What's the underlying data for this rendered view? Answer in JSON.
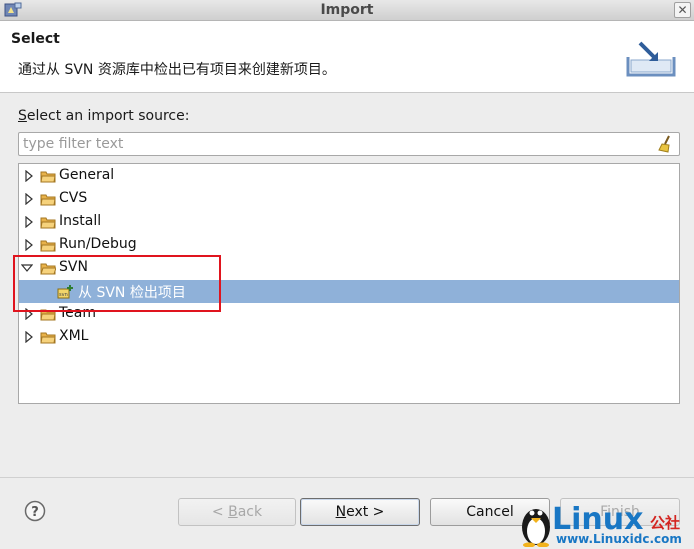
{
  "window": {
    "title": "Import",
    "close_glyph": "✕"
  },
  "header": {
    "title": "Select",
    "description": "通过从 SVN 资源库中检出已有项目来创建新项目。",
    "icon": "import-wizard-icon"
  },
  "source_label": {
    "mnemonic": "S",
    "rest": "elect an import source:"
  },
  "filter": {
    "placeholder": "type filter text",
    "clear_icon": "clear-filter-broom-icon"
  },
  "tree": {
    "items": [
      {
        "label": "General",
        "expanded": false
      },
      {
        "label": "CVS",
        "expanded": false
      },
      {
        "label": "Install",
        "expanded": false
      },
      {
        "label": "Run/Debug",
        "expanded": false
      },
      {
        "label": "SVN",
        "expanded": true
      },
      {
        "label": "从 SVN 检出项目",
        "child": true,
        "selected": true
      },
      {
        "label": "Team",
        "expanded": false
      },
      {
        "label": "XML",
        "expanded": false
      }
    ]
  },
  "buttons": {
    "back": {
      "prefix": "< ",
      "mnemonic": "B",
      "rest": "ack",
      "enabled": false
    },
    "next": {
      "mnemonic": "N",
      "rest": "ext >",
      "enabled": true
    },
    "cancel": {
      "label": "Cancel",
      "enabled": true
    },
    "finish": {
      "label": "Finish",
      "enabled": false
    }
  },
  "watermark": {
    "brand": "Linux",
    "brand_cn": "公社",
    "url": "www.Linuxidc.com"
  },
  "colors": {
    "selection": "#8fb1d9",
    "highlight_box": "#e0141e",
    "folder": "#e8b24a"
  }
}
